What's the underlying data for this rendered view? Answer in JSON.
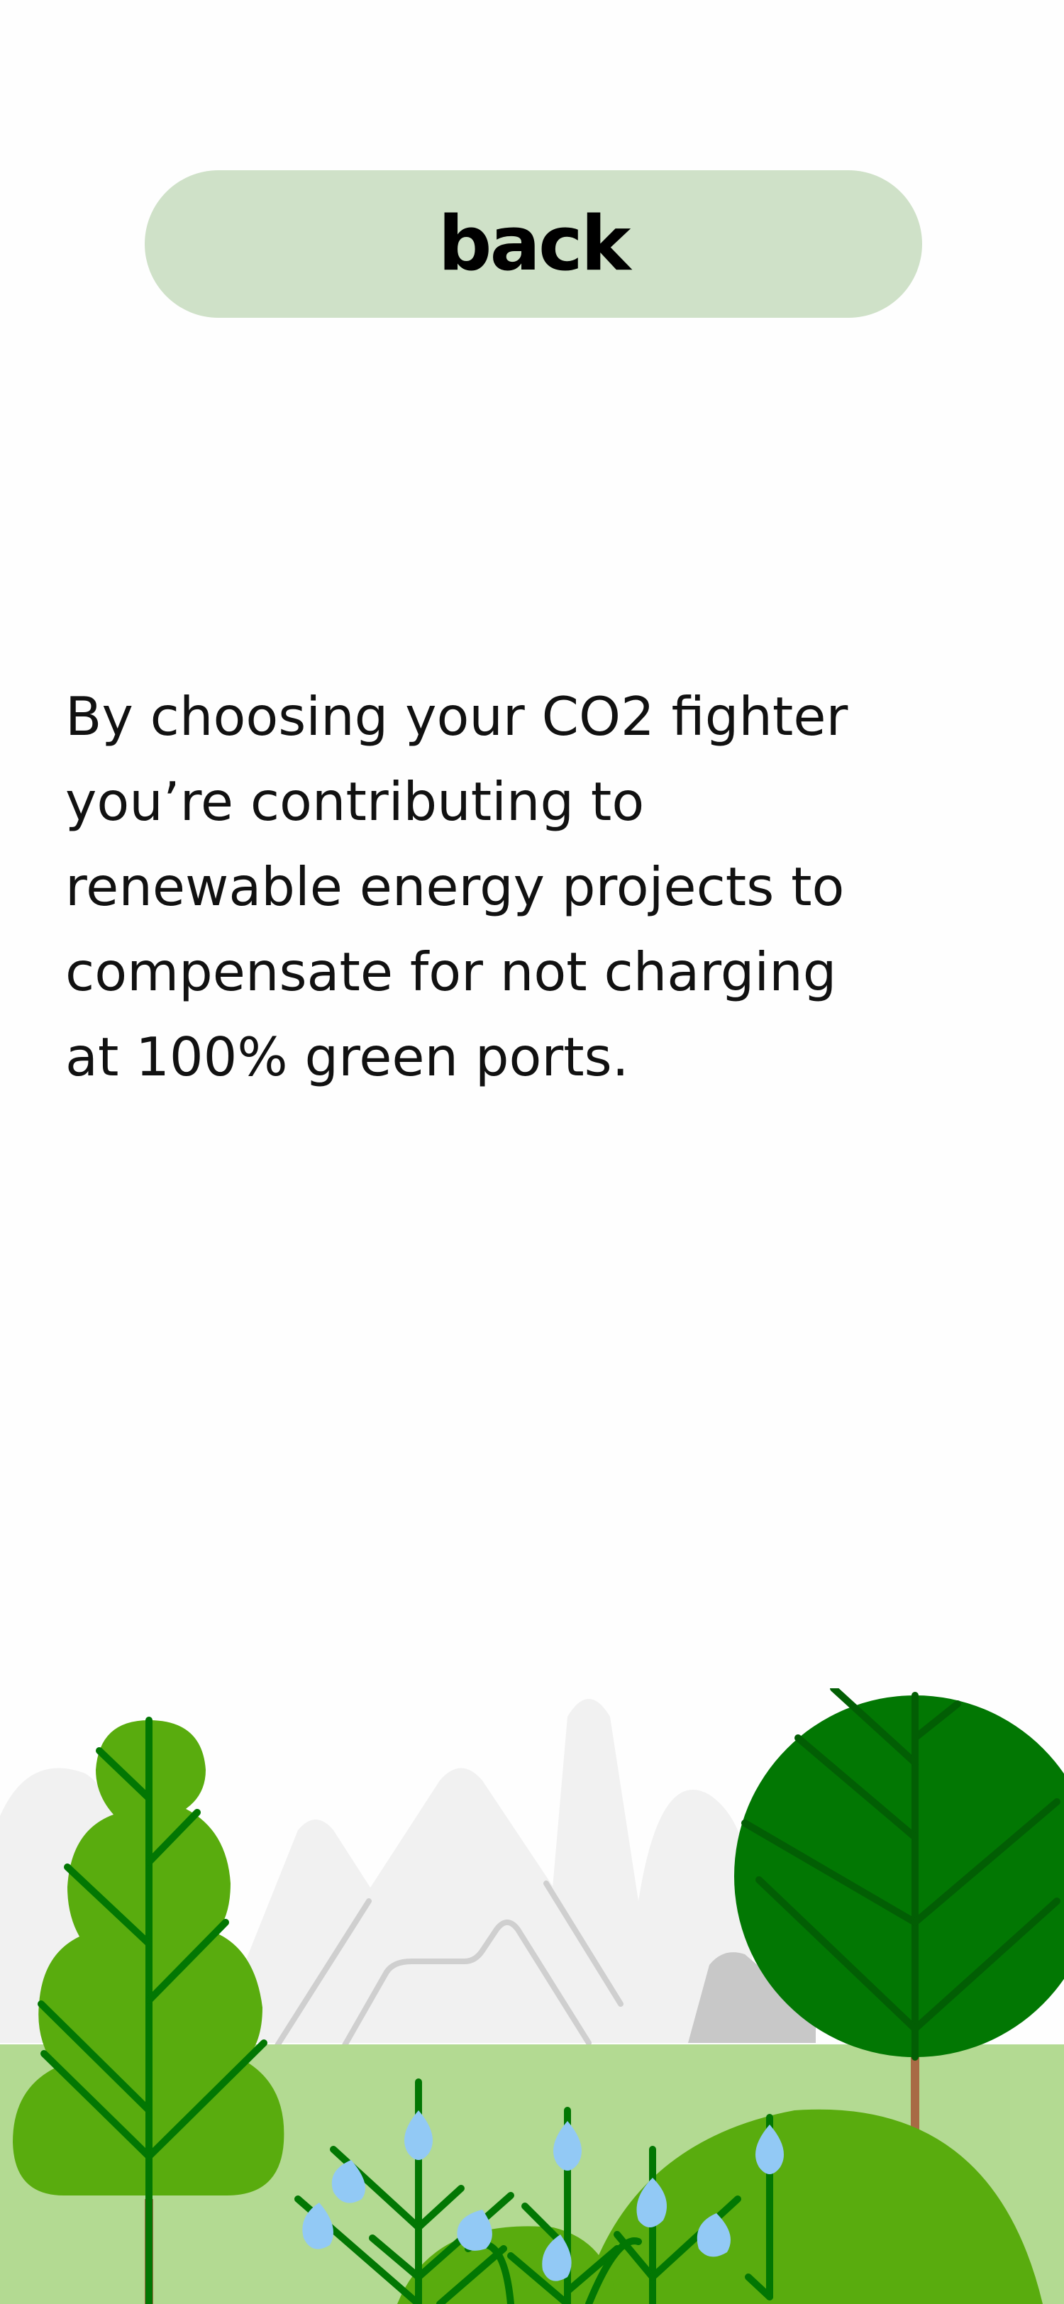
{
  "back_button": {
    "label": "back"
  },
  "info": {
    "text": "By choosing your CO2 fighter\nyou’re contributing to\nrenewable energy projects to\ncompensate for not charging\nat 100% green ports."
  },
  "illustration": {
    "icon": "forest-landscape-illustration"
  },
  "colors": {
    "background": "#FEFEFE",
    "button": "#CFE1C8",
    "text": "#111111",
    "ground": "#B3DA92",
    "light_tree": "#59AC0E",
    "dark_tree": "#027703",
    "branch_dark": "#025E04",
    "trunk": "#A86A45",
    "leaf_blue": "#92C9F5",
    "mountain_light": "#F1F1F1",
    "mountain_dark": "#C8C8C8"
  }
}
